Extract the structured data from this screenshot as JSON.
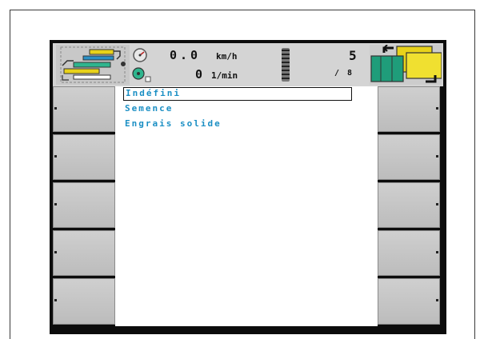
{
  "header": {
    "speed_value": "0.0",
    "speed_unit": "km/h",
    "rpm_value": "0",
    "rpm_unit": "1/min",
    "count_value": "5",
    "count_total": "/ 8"
  },
  "list": {
    "items": [
      {
        "label": "Indéfini",
        "selected": true
      },
      {
        "label": "Semence",
        "selected": false
      },
      {
        "label": "Engrais solide",
        "selected": false
      }
    ]
  },
  "colors": {
    "text_accent": "#1b8fc4",
    "softkey": "#c6c6c6",
    "topbar": "#d4d4d4",
    "bezel": "#0c0c0c"
  },
  "icons": {
    "machine": "machine-icon",
    "speed": "speedometer-icon",
    "rpm": "rpm-sensor-icon",
    "tyre": "tyre-track-icon",
    "sections": "sections-return-icon"
  }
}
